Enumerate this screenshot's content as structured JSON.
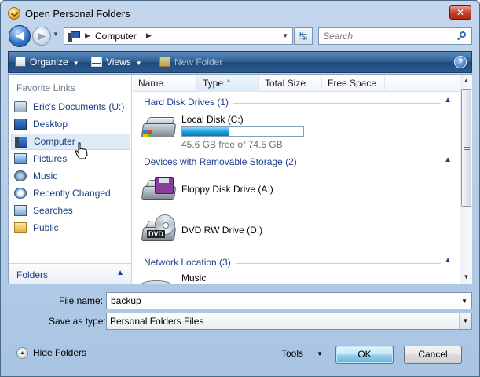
{
  "window": {
    "title": "Open Personal Folders",
    "close_glyph": "✕"
  },
  "nav": {
    "back_glyph": "◀",
    "forward_glyph": "▶"
  },
  "address": {
    "path": "Computer",
    "refresh_glyph": "↹"
  },
  "search": {
    "placeholder": "Search"
  },
  "toolbar": {
    "organize_label": "Organize",
    "views_label": "Views",
    "new_folder_label": "New Folder",
    "help_glyph": "?"
  },
  "sidebar": {
    "heading": "Favorite Links",
    "items": [
      {
        "label": "Eric's Documents (U:)",
        "icon": "documents-icon"
      },
      {
        "label": "Desktop",
        "icon": "desktop-icon"
      },
      {
        "label": "Computer",
        "icon": "computer-icon",
        "selected": true
      },
      {
        "label": "Pictures",
        "icon": "pictures-icon"
      },
      {
        "label": "Music",
        "icon": "music-icon"
      },
      {
        "label": "Recently Changed",
        "icon": "recently-changed-icon"
      },
      {
        "label": "Searches",
        "icon": "searches-icon"
      },
      {
        "label": "Public",
        "icon": "public-folder-icon"
      }
    ],
    "folders_label": "Folders"
  },
  "columns": [
    "Name",
    "Type",
    "Total Size",
    "Free Space"
  ],
  "groups": {
    "hard_disks": "Hard Disk Drives (1)",
    "removable": "Devices with Removable Storage (2)",
    "network": "Network Location (3)"
  },
  "drives": {
    "local": {
      "name": "Local Disk (C:)",
      "free_text": "45.6 GB free of 74.5 GB",
      "used_fraction": 0.39
    },
    "floppy": {
      "name": "Floppy Disk Drive (A:)"
    },
    "dvd": {
      "name": "DVD RW Drive (D:)",
      "badge": "DVD"
    },
    "network_first": {
      "name": "Music"
    }
  },
  "form": {
    "file_name_label": "File name:",
    "file_name_value": "backup",
    "save_type_label": "Save as type:",
    "save_type_value": "Personal Folders Files"
  },
  "footer": {
    "hide_folders_label": "Hide Folders",
    "tools_label": "Tools",
    "ok_label": "OK",
    "cancel_label": "Cancel"
  },
  "colors": {
    "accent": "#2f5d91",
    "link": "#1b3f80",
    "group_header": "#1e3f8f",
    "usage_fill": "#1a9bd4"
  }
}
